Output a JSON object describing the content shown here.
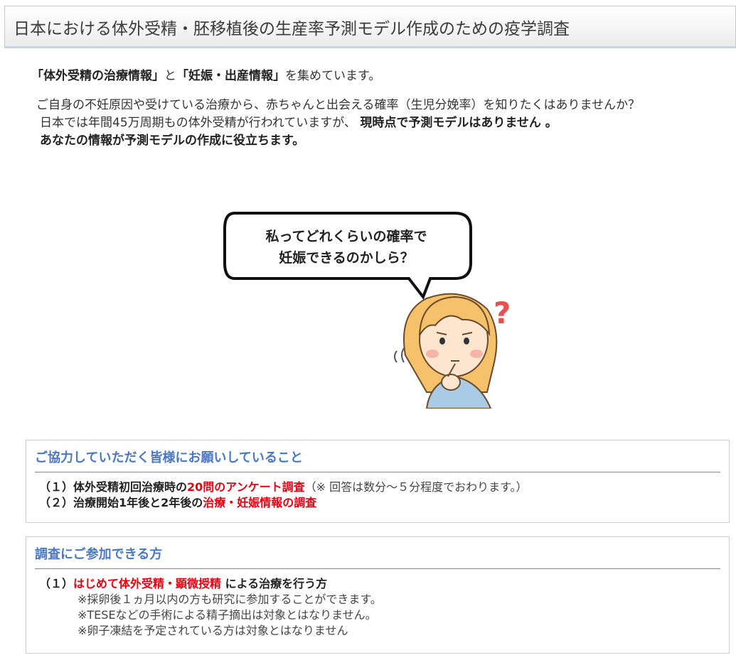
{
  "page": {
    "title": "日本における体外受精・胚移植後の生産率予測モデル作成のための疫学調査"
  },
  "intro": {
    "q1": "「体外受精の治療情報」",
    "to": "と",
    "q2": "「妊娠・出産情報」",
    "collect": "を集めています。",
    "para1": "　ご自身の不妊原因や受けている治療から、赤ちゃんと出会える確率（生児分娩率）を知りたくはありませんか？",
    "para2_plain": "日本では年間45万周期もの体外受精が行われていますが、",
    "para2_bold": "現時点で予測モデルはありません 。",
    "para3": "あなたの情報が予測モデルの作成に役立ちます。"
  },
  "illustration": {
    "bubble_line1": "私ってどれくらいの確率で",
    "bubble_line2": "妊娠できるのかしら？",
    "question_mark": "?"
  },
  "box1": {
    "heading": "ご協力していただく皆様にお願いしていること",
    "items": [
      {
        "prefix": "（１）体外受精初回治療時の",
        "highlight": "20問のアンケート調査",
        "note": "（※ 回答は数分～５分程度でおわります。）"
      },
      {
        "prefix": "（２）治療開始1年後と2年後の",
        "highlight": "治療・妊娠情報の調査",
        "note": ""
      }
    ]
  },
  "box2": {
    "heading": "調査にご参加できる方",
    "item_prefix": "（１）",
    "item_highlight": "はじめて体外受精・顕微授精",
    "item_suffix": " による治療を行う方",
    "notes": [
      "※採卵後１ヵ月以内の方も研究に参加することができます。",
      "※TESEなどの手術による精子摘出は対象とはなりません。",
      "※卵子凍結を予定されている方は対象とはなりません"
    ]
  },
  "colors": {
    "heading_blue": "#4a78c2",
    "highlight_red": "#e60012",
    "question_red": "#e8504f"
  }
}
